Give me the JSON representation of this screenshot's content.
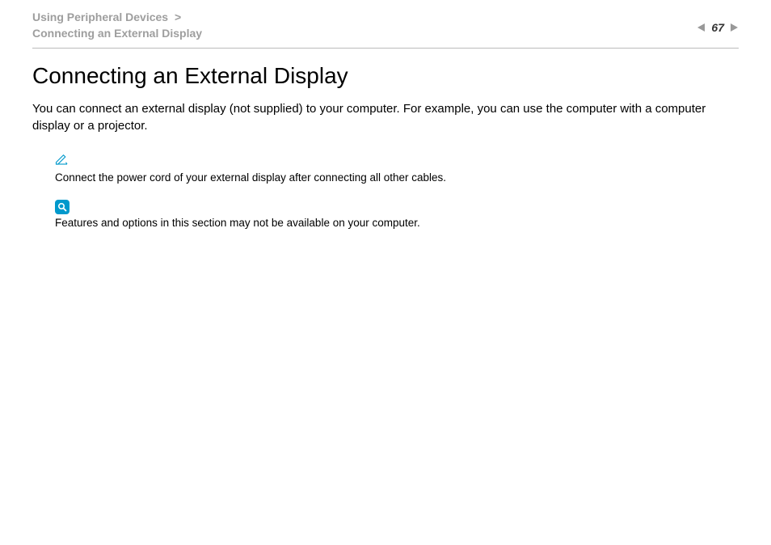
{
  "header": {
    "breadcrumb_section": "Using Peripheral Devices",
    "breadcrumb_separator": ">",
    "breadcrumb_sub": "Connecting an External Display",
    "page_number": "67"
  },
  "main": {
    "title": "Connecting an External Display",
    "intro": "You can connect an external display (not supplied) to your computer. For example, you can use the computer with a computer display or a projector.",
    "notes": [
      {
        "icon": "pencil-icon",
        "text": "Connect the power cord of your external display after connecting all other cables."
      },
      {
        "icon": "search-icon",
        "text": "Features and options in this section may not be available on your computer."
      }
    ]
  }
}
